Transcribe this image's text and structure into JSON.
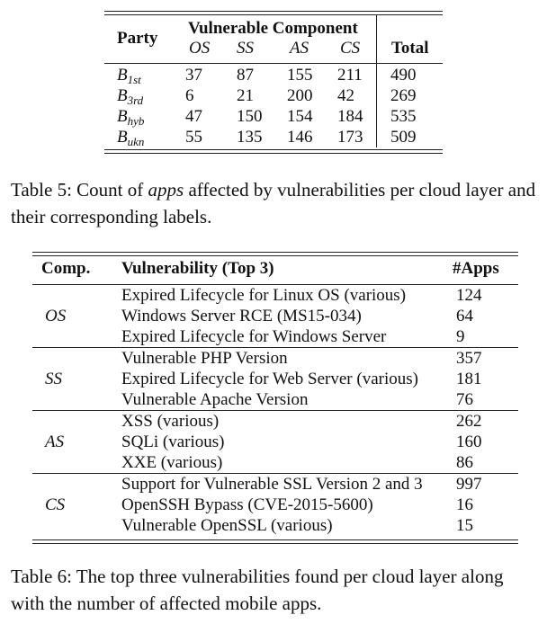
{
  "table5": {
    "header": {
      "party": "Party",
      "group": "Vulnerable Component",
      "cols": [
        "OS",
        "SS",
        "AS",
        "CS"
      ],
      "total": "Total"
    },
    "rows": [
      {
        "party_base": "B",
        "party_sub": "1st",
        "values": [
          "37",
          "87",
          "155",
          "211"
        ],
        "total": "490"
      },
      {
        "party_base": "B",
        "party_sub": "3rd",
        "values": [
          "6",
          "21",
          "200",
          "42"
        ],
        "total": "269"
      },
      {
        "party_base": "B",
        "party_sub": "hyb",
        "values": [
          "47",
          "150",
          "154",
          "184"
        ],
        "total": "535"
      },
      {
        "party_base": "B",
        "party_sub": "ukn",
        "values": [
          "55",
          "135",
          "146",
          "173"
        ],
        "total": "509"
      }
    ],
    "caption": {
      "before": "Table 5: Count of ",
      "emph": "apps",
      "after": " affected by vulnerabilities per cloud layer and their corresponding labels."
    }
  },
  "table6": {
    "header": {
      "comp": "Comp.",
      "vuln": "Vulnerability (Top 3)",
      "apps": "#Apps"
    },
    "groups": [
      {
        "comp": "OS",
        "items": [
          {
            "vuln": "Expired Lifecycle for Linux OS (various)",
            "apps": "124"
          },
          {
            "vuln": "Windows Server RCE (MS15-034)",
            "apps": "64"
          },
          {
            "vuln": "Expired Lifecycle for Windows Server",
            "apps": "9"
          }
        ]
      },
      {
        "comp": "SS",
        "items": [
          {
            "vuln": "Vulnerable PHP Version",
            "apps": "357"
          },
          {
            "vuln": "Expired Lifecycle for Web Server (various)",
            "apps": "181"
          },
          {
            "vuln": "Vulnerable Apache Version",
            "apps": "76"
          }
        ]
      },
      {
        "comp": "AS",
        "items": [
          {
            "vuln": "XSS (various)",
            "apps": "262"
          },
          {
            "vuln": "SQLi (various)",
            "apps": "160"
          },
          {
            "vuln": "XXE (various)",
            "apps": "86"
          }
        ]
      },
      {
        "comp": "CS",
        "items": [
          {
            "vuln": "Support for Vulnerable SSL Version 2 and 3",
            "apps": "997"
          },
          {
            "vuln": "OpenSSH Bypass (CVE-2015-5600)",
            "apps": "16"
          },
          {
            "vuln": "Vulnerable OpenSSL (various)",
            "apps": "15"
          }
        ]
      }
    ],
    "caption": "Table 6: The top three vulnerabilities found per cloud layer along with the number of affected mobile apps."
  }
}
